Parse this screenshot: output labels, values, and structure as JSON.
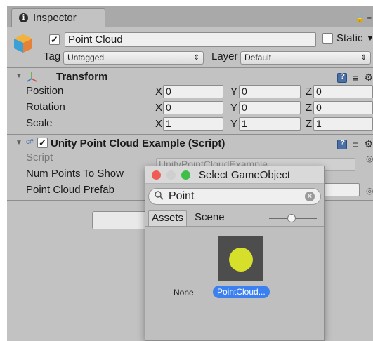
{
  "window": {
    "tab_label": "Inspector",
    "tab_icon": "info-icon",
    "tab_menu_glyph": "☰"
  },
  "gameobject": {
    "name": "Point Cloud",
    "active": true,
    "static_label": "Static",
    "tag_label": "Tag",
    "tag_value": "Untagged",
    "layer_label": "Layer",
    "layer_value": "Default"
  },
  "transform": {
    "title": "Transform",
    "rows": [
      {
        "label": "Position",
        "x": "0",
        "y": "0",
        "z": "0"
      },
      {
        "label": "Rotation",
        "x": "0",
        "y": "0",
        "z": "0"
      },
      {
        "label": "Scale",
        "x": "1",
        "y": "1",
        "z": "1"
      }
    ],
    "axis_labels": {
      "x": "X",
      "y": "Y",
      "z": "Z"
    }
  },
  "script_component": {
    "title": "Unity Point Cloud Example (Script)",
    "enabled": true,
    "script_label": "Script",
    "script_value": "UnityPointCloudExample",
    "num_points_label": "Num Points To Show",
    "prefab_label": "Point Cloud Prefab"
  },
  "popup": {
    "title": "Select GameObject",
    "search_value": "Point",
    "tabs": [
      "Assets",
      "Scene"
    ],
    "active_tab": "Assets",
    "none_label": "None",
    "selected_item": "PointCloud...",
    "traffic_lights": {
      "close": "#ee5c54",
      "minimize": "#cfcfcf",
      "zoom": "#3fbf47"
    },
    "preview_dot_color": "#d6e02a"
  },
  "colors": {
    "panel": "#c2c2c2",
    "selection": "#3b80ee"
  }
}
